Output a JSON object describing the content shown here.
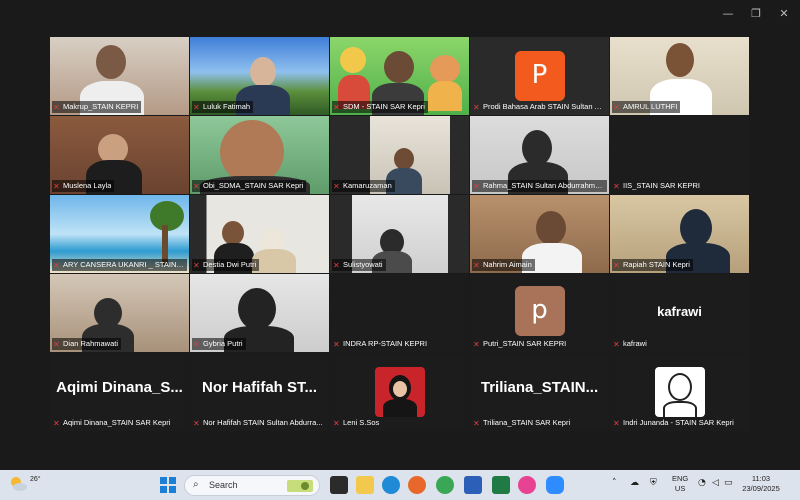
{
  "window": {
    "minimize": "—",
    "maximize": "❐",
    "close": "✕"
  },
  "tiles": [
    {
      "name": "Makrup_STAIN KEPRI"
    },
    {
      "name": "Luluk Fatimah"
    },
    {
      "name": "SDM - STAIN SAR Kepri"
    },
    {
      "name": "Prodi Bahasa Arab STAIN Sultan A...",
      "avatar": "P",
      "avatar_color": "#f25a1e"
    },
    {
      "name": "AMRUL LUTHFI"
    },
    {
      "name": "Muslena Layla"
    },
    {
      "name": "Obi_SDMA_STAIN SAR Kepri"
    },
    {
      "name": "Kamaruzaman"
    },
    {
      "name": "Rahma_STAIN Sultan Abdurrahma..."
    },
    {
      "name": "IIS_STAIN SAR KEPRI"
    },
    {
      "name": "ARY CANSERA UKANRI _ STAIN KE..."
    },
    {
      "name": "Destia Dwi Putri"
    },
    {
      "name": "Sulistyowati"
    },
    {
      "name": "Nahrim Aimain"
    },
    {
      "name": "Rapiah STAIN Kepri"
    },
    {
      "name": "Dian Rahmawati"
    },
    {
      "name": "Gybria Putri"
    },
    {
      "name": "INDRA RP-STAIN KEPRI"
    },
    {
      "name": "Putri_STAIN SAR KEPRI",
      "avatar": "p",
      "avatar_color": "#a9735a"
    },
    {
      "name": "kafrawi",
      "big": "kafrawi"
    },
    {
      "name": "Aqimi Dinana_STAIN SAR Kepri",
      "big": "Aqimi  Dinana_S..."
    },
    {
      "name": "Nor Hafifah STAIN Sultan Abdurra...",
      "big": "Nor Hafifah ST..."
    },
    {
      "name": "Leni S.Sos"
    },
    {
      "name": "Triliana_STAIN SAR Kepri",
      "big": "Triliana_STAIN..."
    },
    {
      "name": "Indri Junanda - STAIN SAR Kepri"
    }
  ],
  "taskbar": {
    "temperature": "26°",
    "search_label": "Search",
    "lang_top": "ENG",
    "lang_bottom": "US",
    "time": "11:03",
    "date": "23/09/2025"
  }
}
